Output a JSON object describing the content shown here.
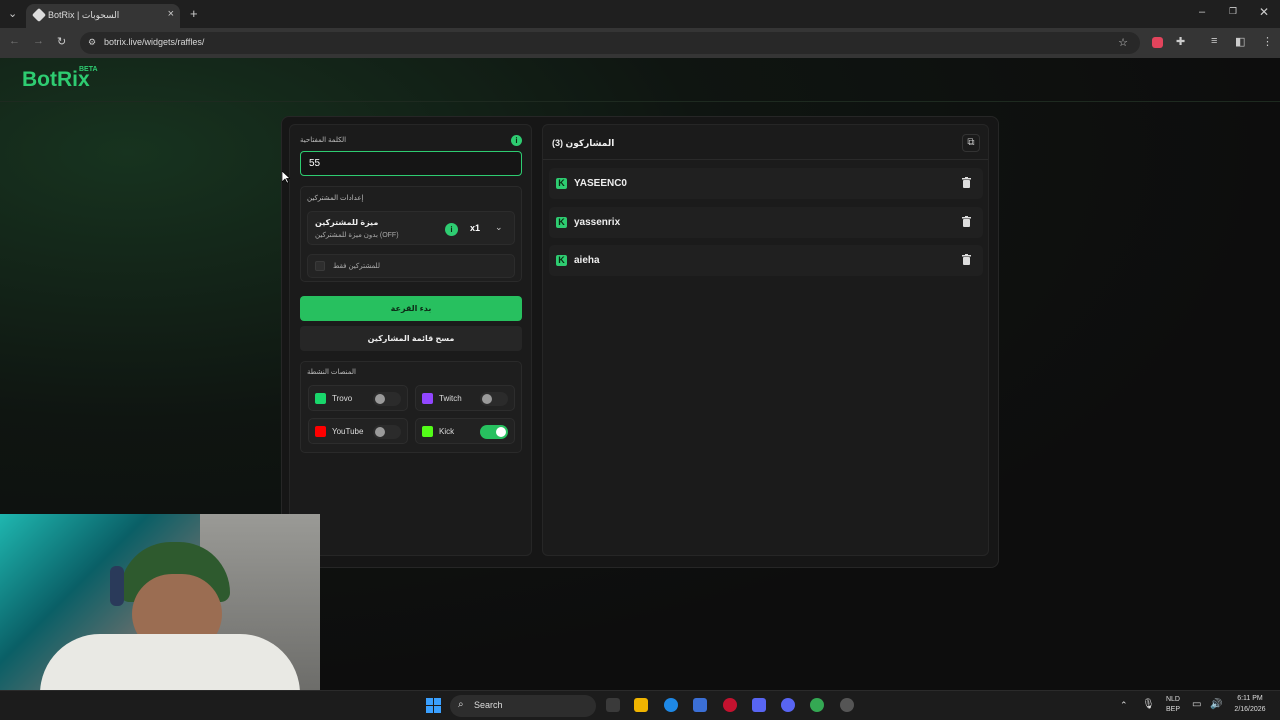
{
  "browser": {
    "tab_title": "BotRix | السحوبات",
    "url": "botrix.live/widgets/raffles/"
  },
  "header": {
    "logo": "BotRix",
    "badge": "BETA"
  },
  "settings": {
    "keyword_label": "الكلمة المفتاحية",
    "keyword_value": "55",
    "participant_settings_label": "إعدادات المشتركين",
    "subscriber_feature_title": "ميزة للمشتركين",
    "subscriber_feature_sub": "بدون ميزة للمشتركين (OFF)",
    "multiplier": "x1",
    "subscribers_only": "للمشتركين فقط",
    "start_button": "بدء القرعة",
    "clear_button": "مسح قائمة المشاركين",
    "active_platforms_label": "المنصات النشطة",
    "platforms": [
      {
        "name": "Trovo",
        "on": false,
        "color": "#19d66b"
      },
      {
        "name": "Twitch",
        "on": false,
        "color": "#9146ff"
      },
      {
        "name": "YouTube",
        "on": false,
        "color": "#ff0000"
      },
      {
        "name": "Kick",
        "on": true,
        "color": "#53fc18"
      }
    ]
  },
  "participants": {
    "title": "المشاركون (3)",
    "list": [
      "YASEENC0",
      "yassenrix",
      "aieha"
    ]
  },
  "taskbar": {
    "search": "Search",
    "lang_top": "NLD",
    "lang_bottom": "BEP",
    "time": "6:11 PM",
    "date": "2/16/2026"
  },
  "colors": {
    "accent": "#2ecc71",
    "panel": "#1b1b1b"
  }
}
